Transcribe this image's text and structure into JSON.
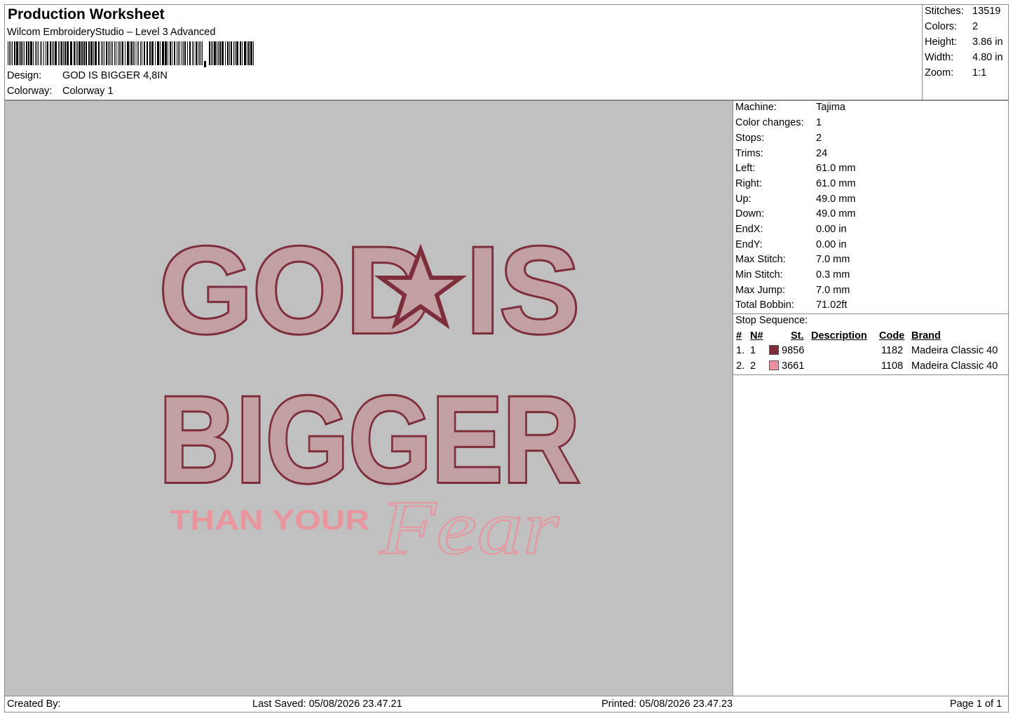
{
  "header": {
    "title": "Production Worksheet",
    "subtitle": "Wilcom EmbroideryStudio – Level 3 Advanced",
    "design_label": "Design:",
    "design_value": "GOD IS BIGGER 4,8IN",
    "colorway_label": "Colorway:",
    "colorway_value": "Colorway 1"
  },
  "stats": [
    {
      "label": "Stitches:",
      "value": "13519"
    },
    {
      "label": "Colors:",
      "value": "2"
    },
    {
      "label": "Height:",
      "value": "3.86 in"
    },
    {
      "label": "Width:",
      "value": "4.80 in"
    },
    {
      "label": "Zoom:",
      "value": "1:1"
    }
  ],
  "machine_info": [
    {
      "label": "Machine:",
      "value": "Tajima"
    },
    {
      "label": "Color changes:",
      "value": "1"
    },
    {
      "label": "Stops:",
      "value": "2"
    },
    {
      "label": "Trims:",
      "value": "24"
    },
    {
      "label": "Left:",
      "value": "61.0 mm"
    },
    {
      "label": "Right:",
      "value": "61.0 mm"
    },
    {
      "label": "Up:",
      "value": "49.0 mm"
    },
    {
      "label": "Down:",
      "value": "49.0 mm"
    },
    {
      "label": "EndX:",
      "value": "0.00 in"
    },
    {
      "label": "EndY:",
      "value": "0.00 in"
    },
    {
      "label": "Max Stitch:",
      "value": "7.0 mm"
    },
    {
      "label": "Min Stitch:",
      "value": "0.3 mm"
    },
    {
      "label": "Max Jump:",
      "value": "7.0 mm"
    },
    {
      "label": "Total Bobbin:",
      "value": "71.02ft"
    }
  ],
  "stop_sequence": {
    "title": "Stop Sequence:",
    "headers": {
      "num": "#",
      "n": "N#",
      "st": "St.",
      "description": "Description",
      "code": "Code",
      "brand": "Brand"
    },
    "rows": [
      {
        "num": "1.",
        "n": "1",
        "color": "#7e2e3a",
        "st": "9856",
        "description": "",
        "code": "1182",
        "brand": "Madeira Classic 40"
      },
      {
        "num": "2.",
        "n": "2",
        "color": "#f08fa0",
        "st": "3661",
        "description": "",
        "code": "1108",
        "brand": "Madeira Classic 40"
      }
    ]
  },
  "design": {
    "line1": "GOD IS",
    "line2": "BIGGER",
    "line3": "THAN YOUR",
    "script": "Fear",
    "background": "#c0c0c0",
    "outline_color": "#7e2e3a",
    "fill_color": "#c29fa1",
    "pink_color": "#e9959d"
  },
  "footer": {
    "created_by": "Created By:",
    "last_saved": "Last Saved: 05/08/2026 23.47.21",
    "printed": "Printed: 05/08/2026 23.47.23",
    "page": "Page 1 of 1"
  }
}
